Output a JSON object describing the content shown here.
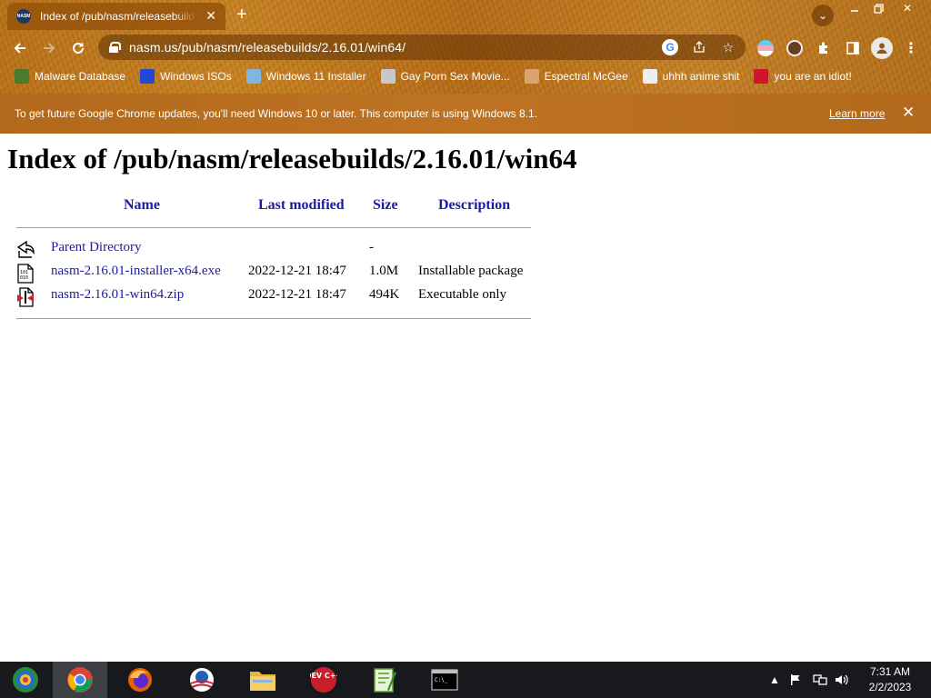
{
  "browser": {
    "tab": {
      "title": "Index of /pub/nasm/releasebuilds",
      "favicon_text": "NASM"
    },
    "omnibox": {
      "url": "nasm.us/pub/nasm/releasebuilds/2.16.01/win64/"
    },
    "bookmarks": [
      {
        "label": "Malware Database",
        "icon": "leaf-icon",
        "color": "#4a7a2a"
      },
      {
        "label": "Windows ISOs",
        "icon": "x-logo-icon",
        "color": "#1f4ad1"
      },
      {
        "label": "Windows 11 Installer",
        "icon": "image-icon",
        "color": "#7fb5e0"
      },
      {
        "label": "Gay Porn Sex Movie...",
        "icon": "robot-icon",
        "color": "#c8c8c8"
      },
      {
        "label": "Espectral McGee",
        "icon": "face-icon",
        "color": "#d9a36b"
      },
      {
        "label": "uhhh anime shit",
        "icon": "anime-icon",
        "color": "#eeeeee"
      },
      {
        "label": "you are an idiot!",
        "icon": "uk-flag-icon",
        "color": "#cf142b"
      }
    ],
    "infobar": {
      "message": "To get future Google Chrome updates, you'll need Windows 10 or later. This computer is using Windows 8.1.",
      "link": "Learn more"
    }
  },
  "page": {
    "heading": "Index of /pub/nasm/releasebuilds/2.16.01/win64",
    "columns": {
      "name": "Name",
      "modified": "Last modified",
      "size": "Size",
      "description": "Description"
    },
    "rows": [
      {
        "name": "Parent Directory",
        "modified": "",
        "size": "-",
        "description": "",
        "icon": "back-arrow-icon"
      },
      {
        "name": "nasm-2.16.01-installer-x64.exe",
        "modified": "2022-12-21 18:47",
        "size": "1.0M",
        "description": "Installable package",
        "icon": "binary-file-icon"
      },
      {
        "name": "nasm-2.16.01-win64.zip",
        "modified": "2022-12-21 18:47",
        "size": "494K",
        "description": "Executable only",
        "icon": "compressed-file-icon"
      }
    ]
  },
  "taskbar": {
    "apps": [
      {
        "name": "start",
        "icon": "start-icon"
      },
      {
        "name": "chrome",
        "icon": "chrome-icon",
        "active": true
      },
      {
        "name": "firefox",
        "icon": "firefox-icon"
      },
      {
        "name": "obama",
        "icon": "obama-logo-icon"
      },
      {
        "name": "file explorer",
        "icon": "folder-icon"
      },
      {
        "name": "dev-c++",
        "icon": "devcpp-icon",
        "label": "DEV C++"
      },
      {
        "name": "notepad++",
        "icon": "notepadpp-icon"
      },
      {
        "name": "command prompt",
        "icon": "cmd-icon",
        "label": "C:\\_"
      }
    ],
    "clock": {
      "time": "7:31 AM",
      "date": "2/2/2023"
    }
  },
  "colors": {
    "chrome_accent": "#b9731b",
    "link": "#1a1aa6",
    "taskbar": "#17191c"
  }
}
